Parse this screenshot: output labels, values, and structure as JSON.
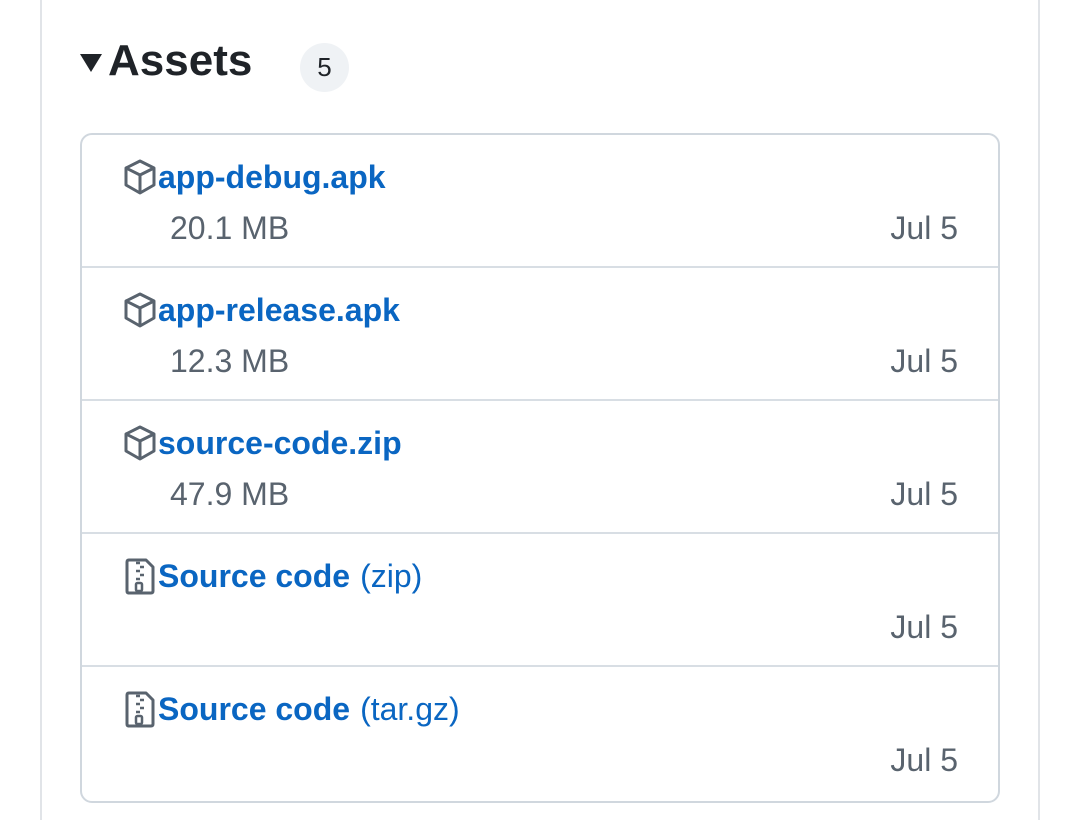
{
  "assets": {
    "title": "Assets",
    "count": "5",
    "items": [
      {
        "name": "app-debug.apk",
        "suffix": "",
        "size": "20.1 MB",
        "date": "Jul 5",
        "icon": "package-icon"
      },
      {
        "name": "app-release.apk",
        "suffix": "",
        "size": "12.3 MB",
        "date": "Jul 5",
        "icon": "package-icon"
      },
      {
        "name": "source-code.zip",
        "suffix": "",
        "size": "47.9 MB",
        "date": "Jul 5",
        "icon": "package-icon"
      },
      {
        "name": "Source code",
        "suffix": "(zip)",
        "size": "",
        "date": "Jul 5",
        "icon": "file-zip-icon"
      },
      {
        "name": "Source code",
        "suffix": "(tar.gz)",
        "size": "",
        "date": "Jul 5",
        "icon": "file-zip-icon"
      }
    ]
  },
  "colors": {
    "link": "#0a66c2",
    "muted": "#59636e",
    "border": "#d0d7de",
    "badge_bg": "#eff2f5"
  }
}
